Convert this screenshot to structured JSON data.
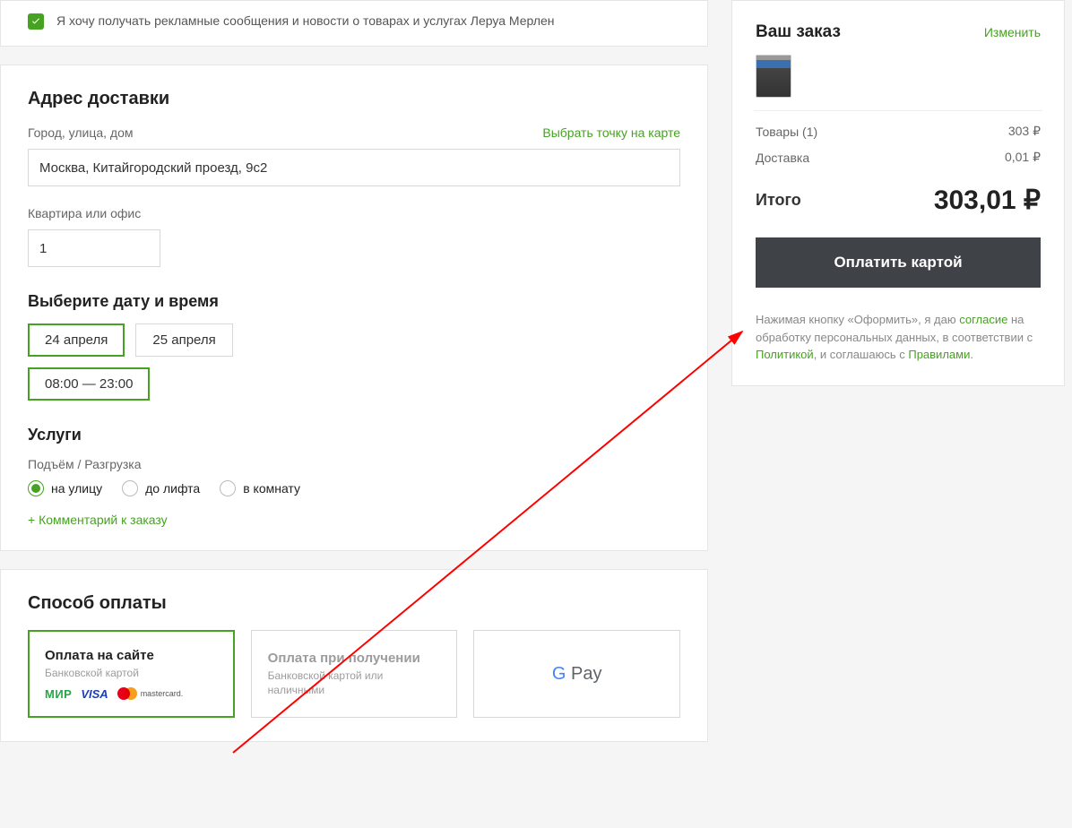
{
  "marketing": {
    "label": "Я хочу получать рекламные сообщения и новости о товарах и услугах Леруа Мерлен",
    "checked": true
  },
  "delivery": {
    "heading": "Адрес доставки",
    "city_label": "Город, улица, дом",
    "map_link": "Выбрать точку на карте",
    "address_value": "Москва, Китайгородский проезд, 9с2",
    "apt_label": "Квартира или офис",
    "apt_value": "1",
    "date_heading": "Выберите дату и время",
    "dates": [
      "24 апреля",
      "25 апреля"
    ],
    "date_selected": 0,
    "times": [
      "08:00 — 23:00"
    ],
    "time_selected": 0,
    "services_heading": "Услуги",
    "lift_label": "Подъём / Разгрузка",
    "lift_options": [
      "на улицу",
      "до лифта",
      "в комнату"
    ],
    "lift_selected": 0,
    "comment_link": "+ Комментарий к заказу"
  },
  "payment": {
    "heading": "Способ оплаты",
    "options": [
      {
        "title": "Оплата на сайте",
        "sub": "Банковской картой"
      },
      {
        "title": "Оплата при получении",
        "sub": "Банковской картой или наличными"
      },
      {
        "title": "G Pay"
      }
    ],
    "logos": {
      "mir": "МИР",
      "visa": "VISA",
      "mc": "mastercard."
    }
  },
  "order": {
    "title": "Ваш заказ",
    "edit_link": "Изменить",
    "items_label": "Товары (1)",
    "items_price": "303 ₽",
    "delivery_label": "Доставка",
    "delivery_price": "0,01 ₽",
    "total_label": "Итого",
    "total_price": "303,01 ₽",
    "pay_button": "Оплатить картой",
    "footnote_pre": "Нажимая кнопку «Оформить», я даю ",
    "footnote_consent": "согласие",
    "footnote_mid": " на обработку персональных данных, в соответствии с ",
    "footnote_policy": "Политикой",
    "footnote_mid2": ", и соглашаюсь с ",
    "footnote_rules": "Правилами",
    "footnote_end": "."
  }
}
